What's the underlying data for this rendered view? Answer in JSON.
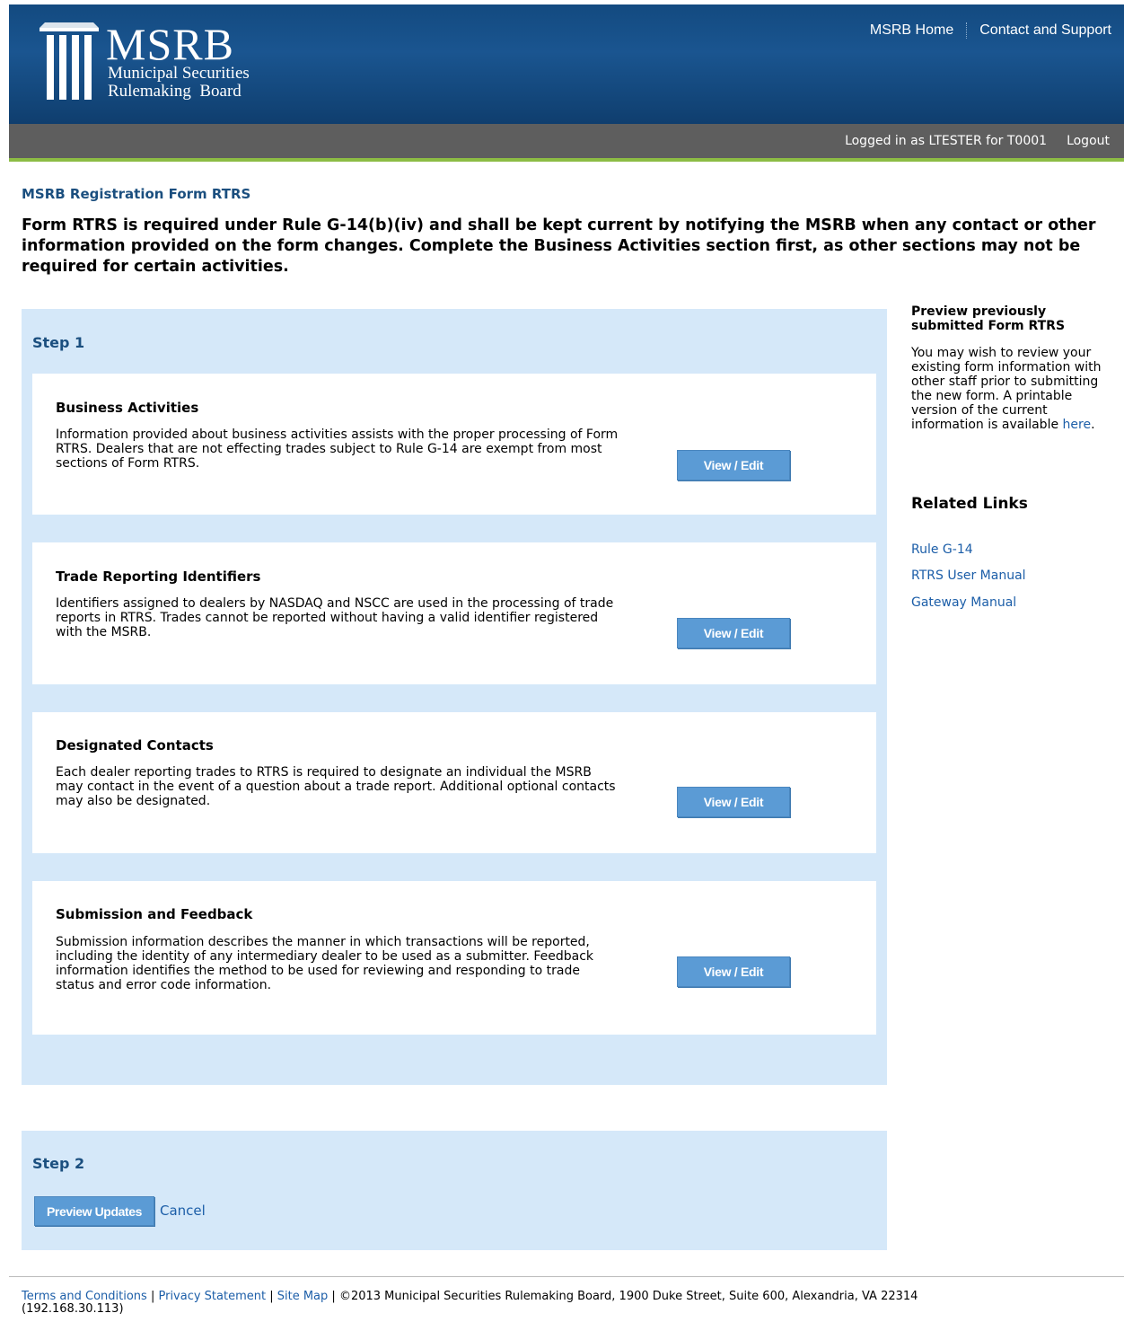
{
  "header": {
    "logo_main": "MSRB",
    "logo_line1": "Municipal Securities",
    "logo_line2": "Rulemaking  Board",
    "links": [
      "MSRB Home",
      "Contact and Support"
    ],
    "brand_color": "#134a80",
    "accent_color": "#8cbc44"
  },
  "userbar": {
    "logged_in_text": "Logged in as LTESTER for T0001",
    "logout_label": "Logout"
  },
  "page": {
    "title": "MSRB Registration Form RTRS",
    "intro": "Form RTRS is required under Rule G-14(b)(iv) and shall be kept current by notifying the MSRB when any contact or other information provided on the form changes. Complete the Business Activities section first, as other sections may not be required for certain activities."
  },
  "step1": {
    "heading": "Step 1",
    "button_label": "View / Edit",
    "sections": [
      {
        "title": "Business Activities",
        "description": "Information provided about business activities assists with the proper processing of Form RTRS. Dealers that are not effecting trades subject to Rule G-14 are exempt from most sections of Form RTRS."
      },
      {
        "title": "Trade Reporting Identifiers",
        "description": "Identifiers assigned to dealers by NASDAQ and NSCC are used in the processing of trade reports in RTRS. Trades cannot be reported without having a valid identifier registered with the MSRB."
      },
      {
        "title": "Designated Contacts",
        "description": "Each dealer reporting trades to RTRS is required to designate an individual the MSRB may contact in the event of a question about a trade report. Additional optional contacts may also be designated."
      },
      {
        "title": "Submission and Feedback",
        "description": "Submission information describes the manner in which transactions will be reported, including the identity of any intermediary dealer to be used as a submitter. Feedback information identifies the method to be used for reviewing and responding to trade status and error code information."
      }
    ]
  },
  "step2": {
    "heading": "Step 2",
    "preview_label": "Preview Updates",
    "cancel_label": "Cancel"
  },
  "sidebar": {
    "preview_heading": "Preview previously submitted Form RTRS",
    "preview_text": "You may wish to review your existing form information with other staff prior to submitting the new form. A printable version of the current information is available",
    "preview_link": "here",
    "related_heading": "Related Links",
    "related_links": [
      "Rule G-14",
      "RTRS User Manual",
      "Gateway Manual"
    ]
  },
  "footer": {
    "links": [
      "Terms and Conditions",
      "Privacy Statement",
      "Site Map"
    ],
    "copyright": "©2013 Municipal Securities Rulemaking Board, 1900 Duke Street, Suite 600, Alexandria, VA 22314",
    "ip": "(192.168.30.113)"
  }
}
